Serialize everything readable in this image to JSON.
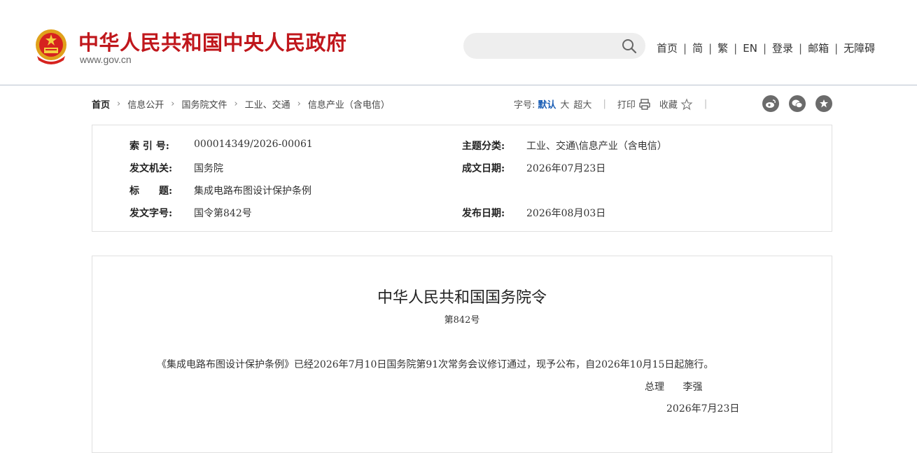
{
  "site": {
    "title": "中华人民共和国中央人民政府",
    "url": "www.gov.cn",
    "brand_color": "#c0171c"
  },
  "search": {
    "placeholder": "",
    "icon": "search-icon"
  },
  "top_links": [
    "首页",
    "简",
    "繁",
    "EN",
    "登录",
    "邮箱",
    "无障碍"
  ],
  "breadcrumb": [
    "首页",
    "信息公开",
    "国务院文件",
    "工业、交通",
    "信息产业（含电信）"
  ],
  "tools": {
    "font_size_label": "字号:",
    "sizes": [
      "默认",
      "大",
      "超大"
    ],
    "active_size": "默认",
    "print_label": "打印",
    "favorite_label": "收藏",
    "share_icons": [
      "weibo-icon",
      "wechat-icon",
      "star-circle-icon"
    ],
    "accent_color": "#1b5eb5"
  },
  "meta": {
    "index_no": {
      "label": "索 引 号:",
      "value": "000014349/2026-00061"
    },
    "category": {
      "label": "主题分类:",
      "value": "工业、交通\\信息产业（含电信）"
    },
    "issuer": {
      "label": "发文机关:",
      "value": "国务院"
    },
    "written_date": {
      "label": "成文日期:",
      "value": "2026年07月23日"
    },
    "title": {
      "label": "标　　题:",
      "value": "集成电路布图设计保护条例"
    },
    "doc_no": {
      "label": "发文字号:",
      "value": "国令第842号"
    },
    "publish_date": {
      "label": "发布日期:",
      "value": "2026年08月03日"
    }
  },
  "document": {
    "heading": "中华人民共和国国务院令",
    "number": "第842号",
    "body": "《集成电路布图设计保护条例》已经2026年7月10日国务院第91次常务会议修订通过，现予公布，自2026年10月15日起施行。",
    "signer_title": "总理",
    "signer_name": "李强",
    "date": "2026年7月23日"
  }
}
